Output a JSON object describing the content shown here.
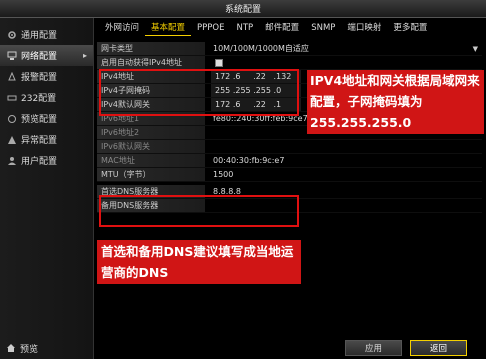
{
  "window": {
    "title": "系统配置"
  },
  "sidebar": {
    "items": [
      {
        "label": "通用配置",
        "icon": "gear-icon"
      },
      {
        "label": "网络配置",
        "icon": "network-icon",
        "active": true
      },
      {
        "label": "报警配置",
        "icon": "alarm-icon"
      },
      {
        "label": "232配置",
        "icon": "serial-icon"
      },
      {
        "label": "预览配置",
        "icon": "preview-icon"
      },
      {
        "label": "异常配置",
        "icon": "warning-icon"
      },
      {
        "label": "用户配置",
        "icon": "user-icon"
      }
    ],
    "preview_label": "预览"
  },
  "tabs": [
    "外网访问",
    "基本配置",
    "PPPOE",
    "NTP",
    "邮件配置",
    "SNMP",
    "端口映射",
    "更多配置"
  ],
  "active_tab": "基本配置",
  "form": {
    "nic_type": {
      "label": "网卡类型",
      "value": "10M/100M/1000M自适应"
    },
    "dhcp": {
      "label": "启用自动获得IPv4地址"
    },
    "ipv4_addr": {
      "label": "IPv4地址",
      "value": "172 .6     .22   .132"
    },
    "ipv4_mask": {
      "label": "IPv4子网掩码",
      "value": "255 .255 .255 .0"
    },
    "ipv4_gw": {
      "label": "IPv4默认网关",
      "value": "172 .6     .22   .1"
    },
    "ipv6_1": {
      "label": "IPv6地址1",
      "value": "fe80::240:30ff:feb:9ce7"
    },
    "ipv6_2": {
      "label": "IPv6地址2",
      "value": ""
    },
    "ipv6_gw": {
      "label": "IPv6默认网关",
      "value": ""
    },
    "mac": {
      "label": "MAC地址",
      "value": "00:40:30:fb:9c:e7"
    },
    "mtu": {
      "label": "MTU（字节）",
      "value": "1500"
    },
    "dns1": {
      "label": "首选DNS服务器",
      "value": "8.8.8.8"
    },
    "dns2": {
      "label": "备用DNS服务器",
      "value": ""
    }
  },
  "annotations": {
    "ip_note": "IPV4地址和网关根据局域网来配置，子网掩码填为255.255.255.0",
    "dns_note": "首选和备用DNS建议填写成当地运营商的DNS"
  },
  "buttons": {
    "apply": "应用",
    "back": "返回"
  },
  "colors": {
    "accent": "#f5d000",
    "annotation_red": "#d01515"
  }
}
